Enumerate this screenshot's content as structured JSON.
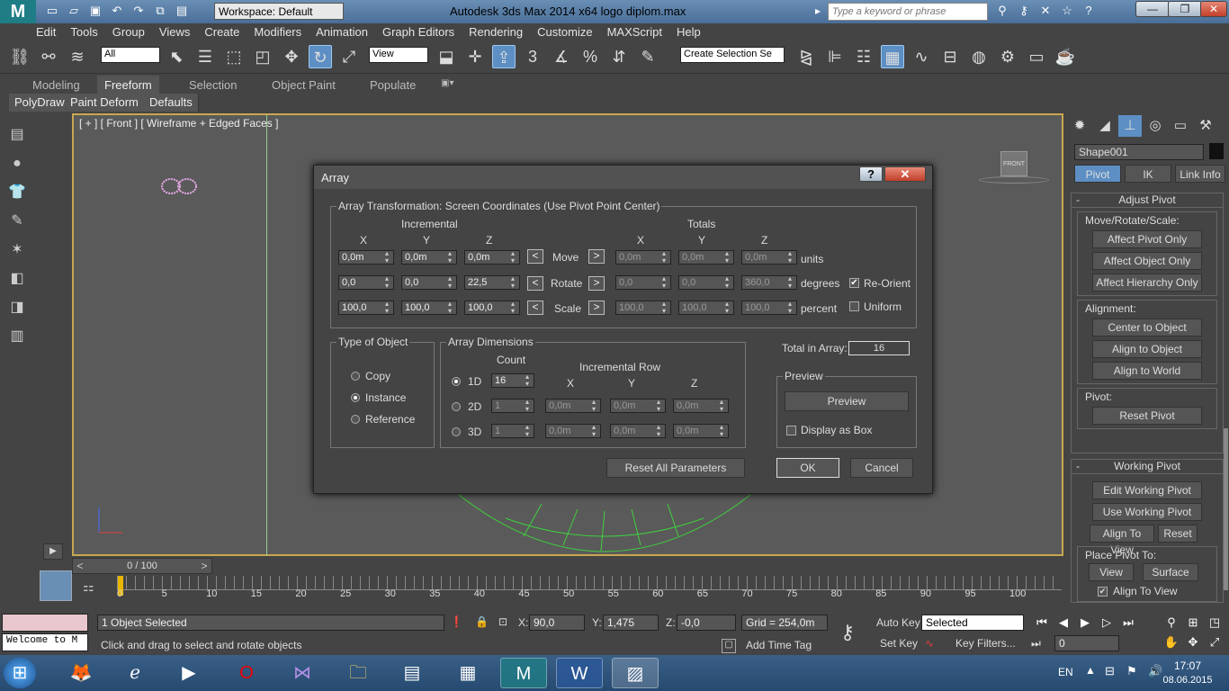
{
  "titlebar": {
    "logo": "M",
    "workspace": "Workspace: Default",
    "app_title": "Autodesk 3ds Max  2014 x64     logo diplom.max",
    "search_placeholder": "Type a keyword or phrase",
    "min": "—",
    "max": "❐",
    "close": "✕"
  },
  "menu": [
    "Edit",
    "Tools",
    "Group",
    "Views",
    "Create",
    "Modifiers",
    "Animation",
    "Graph Editors",
    "Rendering",
    "Customize",
    "MAXScript",
    "Help"
  ],
  "toolbar": {
    "filter": "All",
    "ref_coord": "View",
    "selection_set_placeholder": "Create Selection Se"
  },
  "ribbon": {
    "tabs": [
      "Modeling",
      "Freeform",
      "Selection",
      "Object Paint",
      "Populate"
    ],
    "subtabs": [
      "PolyDraw",
      "Paint Deform",
      "Defaults"
    ]
  },
  "viewport": {
    "label": "[ + ] [ Front ] [ Wireframe + Edged Faces ]",
    "viewcube": "FRONT"
  },
  "right_panel": {
    "object_name": "Shape001",
    "tabs": [
      "Pivot",
      "IK",
      "Link Info"
    ],
    "adjust_pivot": {
      "title": "Adjust Pivot",
      "move_group": "Move/Rotate/Scale:",
      "move_buttons": [
        "Affect Pivot Only",
        "Affect Object Only",
        "Affect Hierarchy Only"
      ],
      "align_group": "Alignment:",
      "align_buttons": [
        "Center to Object",
        "Align to Object",
        "Align to World"
      ],
      "pivot_group": "Pivot:",
      "pivot_buttons": [
        "Reset Pivot"
      ]
    },
    "working_pivot": {
      "title": "Working Pivot",
      "buttons": [
        "Edit Working Pivot",
        "Use Working Pivot"
      ],
      "align_view": "Align To View",
      "reset": "Reset",
      "place_to": "Place Pivot To:",
      "view": "View",
      "surface": "Surface",
      "align_to_view_cb": "Align To View"
    },
    "collapse": "-"
  },
  "timeline": {
    "position": "0 / 100",
    "ticks": [
      "0",
      "5",
      "10",
      "15",
      "20",
      "25",
      "30",
      "35",
      "40",
      "45",
      "50",
      "55",
      "60",
      "65",
      "70",
      "75",
      "80",
      "85",
      "90",
      "95",
      "100"
    ]
  },
  "status": {
    "maxscript": "Welcome to M",
    "selected": "1 Object Selected",
    "prompt": "Click and drag to select and rotate objects",
    "x_label": "X:",
    "x": "90,0",
    "y_label": "Y:",
    "y": "1,475",
    "z_label": "Z:",
    "z": "-0,0",
    "grid": "Grid = 254,0m",
    "add_time_tag": "Add Time Tag",
    "auto_key": "Auto Key",
    "set_key": "Set Key",
    "key_mode": "Selected",
    "key_filters": "Key Filters...",
    "frame": "0"
  },
  "taskbar": {
    "lang": "EN",
    "time": "17:07",
    "date": "08.06.2015"
  },
  "dialog": {
    "title": "Array",
    "help": "?",
    "close": "✕",
    "transform_group": "Array Transformation: Screen Coordinates (Use Pivot Point Center)",
    "incremental": "Incremental",
    "totals": "Totals",
    "axes": [
      "X",
      "Y",
      "Z"
    ],
    "rows": [
      {
        "label": "Move",
        "inc": [
          "0,0m",
          "0,0m",
          "0,0m"
        ],
        "tot": [
          "0,0m",
          "0,0m",
          "0,0m"
        ],
        "unit": "units"
      },
      {
        "label": "Rotate",
        "inc": [
          "0,0",
          "0,0",
          "22,5"
        ],
        "tot": [
          "0,0",
          "0,0",
          "360,0"
        ],
        "unit": "degrees"
      },
      {
        "label": "Scale",
        "inc": [
          "100,0",
          "100,0",
          "100,0"
        ],
        "tot": [
          "100,0",
          "100,0",
          "100,0"
        ],
        "unit": "percent"
      }
    ],
    "reorient": "Re-Orient",
    "uniform": "Uniform",
    "arrow_left": "<",
    "arrow_right": ">",
    "type_group": "Type of Object",
    "types": [
      "Copy",
      "Instance",
      "Reference"
    ],
    "dims_group": "Array Dimensions",
    "count": "Count",
    "inc_row": "Incremental Row",
    "dims": [
      {
        "label": "1D",
        "count": "16"
      },
      {
        "label": "2D",
        "count": "1",
        "vals": [
          "0,0m",
          "0,0m",
          "0,0m"
        ]
      },
      {
        "label": "3D",
        "count": "1",
        "vals": [
          "0,0m",
          "0,0m",
          "0,0m"
        ]
      }
    ],
    "total_label": "Total in Array:",
    "total_value": "16",
    "preview_group": "Preview",
    "preview_btn": "Preview",
    "display_box": "Display as Box",
    "reset_btn": "Reset All Parameters",
    "ok": "OK",
    "cancel": "Cancel"
  },
  "colors": {
    "accent": "#5d8fc4",
    "viewport_border": "#c8a74f",
    "wire": "#3fd13f"
  }
}
